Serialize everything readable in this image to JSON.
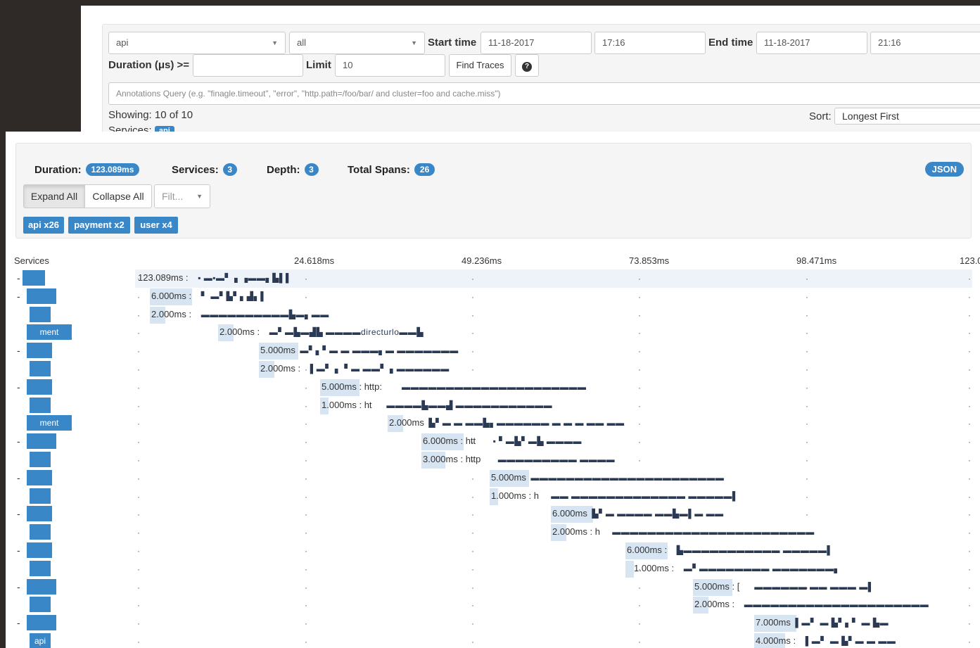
{
  "search": {
    "service_value": "api",
    "span_value": "all",
    "start_time_label": "Start time",
    "start_date": "11-18-2017",
    "start_time": "17:16",
    "end_time_label": "End time",
    "end_date": "11-18-2017",
    "end_time": "21:16",
    "duration_label": "Duration (μs) >=",
    "duration_value": "",
    "limit_label": "Limit",
    "limit_value": "10",
    "find_button": "Find Traces",
    "help_icon": "?",
    "annotations_placeholder": "Annotations Query (e.g. \"finagle.timeout\", \"error\", \"http.path=/foo/bar/ and cluster=foo and cache.miss\")",
    "showing": "Showing: 10 of 10",
    "services_label": "Services:",
    "services_badge": "api",
    "sort_label": "Sort:",
    "sort_value": "Longest First"
  },
  "trace": {
    "duration_label": "Duration:",
    "duration_value": "123.089ms",
    "services_label": "Services:",
    "services_value": "3",
    "depth_label": "Depth:",
    "depth_value": "3",
    "total_spans_label": "Total Spans:",
    "total_spans_value": "26",
    "json_button": "JSON",
    "expand_all": "Expand All",
    "collapse_all": "Collapse All",
    "filter_placeholder": "Filt...",
    "service_buttons": [
      "api x26",
      "payment x2",
      "user x4"
    ],
    "services_header": "Services",
    "axis_ticks": [
      "24.618ms",
      "49.236ms",
      "73.853ms",
      "98.471ms",
      "123.0"
    ],
    "rows": [
      {
        "toggle": "-",
        "service": "",
        "duration": "123.089ms :",
        "desc": "▪ ▬▪▬▘ ▖▗▬▬▖▙▌▌",
        "highlight": true
      },
      {
        "toggle": "-",
        "service": "",
        "duration": "6.000ms :",
        "desc": "▘ ▬▘▙▘▖▟▖▌",
        "highlight": false
      },
      {
        "toggle": "",
        "service": "",
        "duration": "2.000ms :",
        "desc": "▬▬▬▬▬▬▬▬▬▬▙▬▖▬▬",
        "highlight": false
      },
      {
        "toggle": "",
        "service": "ment",
        "duration": "2.000ms :",
        "desc": "▬▘▬▙▬▟▙ ▬▬▬▬directurlo▬▬▙",
        "highlight": false
      },
      {
        "toggle": "-",
        "service": "",
        "duration": "5.000ms",
        "desc": "▬▘▖▘▬ ▬ ▬▬▬▖▬ ▬▬▬▬▬▬▬",
        "highlight": false
      },
      {
        "toggle": "",
        "service": "",
        "duration": "2.000ms :",
        "desc": "▌▬▘ ▖ ▘▬ ▬▬▘ ▖▬▬▬▬▬▬",
        "highlight": false
      },
      {
        "toggle": "-",
        "service": "",
        "duration": "5.000ms : http:",
        "desc": "▬▬▬▬▬▬▬▬▬▬▬▬▬▬▬▬▬▬▬▬▬",
        "highlight": false
      },
      {
        "toggle": "",
        "service": "",
        "duration": "1.000ms : ht",
        "desc": "▬▬▬▬▙▬▬▟ ▬▬▬▬▬▬▬▬▬▬▬",
        "highlight": false
      },
      {
        "toggle": "",
        "service": "ment",
        "duration": "2.000ms",
        "desc": "▙▘▬ ▬ ▬▬▙▖▬▬▬▬▬▬ ▬ ▬ ▬ ▬▬ ▬▬",
        "highlight": false
      },
      {
        "toggle": "-",
        "service": "",
        "duration": "6.000ms : htt",
        "desc": "▪ ▘▬▙▘▬▙ ▬▬▬▬",
        "highlight": false
      },
      {
        "toggle": "",
        "service": "",
        "duration": "3.000ms : http",
        "desc": "▬▬▬▬▬▬▬▬▬ ▬▬▬▬",
        "highlight": false
      },
      {
        "toggle": "-",
        "service": "",
        "duration": "5.000ms",
        "desc": "▬▬▬▬▬▬▬▬▬▬▬▬▬▬▬▬▬▬▬▬▬▬",
        "highlight": false
      },
      {
        "toggle": "",
        "service": "",
        "duration": "1.000ms : h",
        "desc": "▬▬ ▬▬▬▬▬▬▬▬▬▬▬▬▬ ▬▬▬▬▬▌",
        "highlight": false
      },
      {
        "toggle": "-",
        "service": "",
        "duration": "6.000ms",
        "desc": "▙▘▬ ▬▬▬▬ ▬▬▙▬▌▬ ▬▬",
        "highlight": false
      },
      {
        "toggle": "",
        "service": "",
        "duration": "2.000ms : h",
        "desc": "▬▬▬▬▬▬▬▬▬▬▬▬▬▬▬▬▬▬▬▬▬▬▬",
        "highlight": false
      },
      {
        "toggle": "-",
        "service": "",
        "duration": "6.000ms :",
        "desc": "▙▬▬▬▬▬▬▬▬▬▬▬ ▬▬▬▬▬▌",
        "highlight": false
      },
      {
        "toggle": "",
        "service": "",
        "duration": "1.000ms :",
        "desc": "▬▘▬▬▬▬▬▬▬▬ ▬▬▬▬▬▬▬▖",
        "highlight": false
      },
      {
        "toggle": "-",
        "service": "",
        "duration": "5.000ms : [",
        "desc": "▬▬▬▬▬▬ ▬▬ ▬▬▬ ▬▌",
        "highlight": false
      },
      {
        "toggle": "",
        "service": "",
        "duration": "2.000ms :",
        "desc": "▬▬▬▬▬▬▬▬▬▬▬▬▬▬▬▬▬▬▬▬▬",
        "highlight": false
      },
      {
        "toggle": "-",
        "service": "",
        "duration": "7.000ms",
        "desc": "▌▬▘ ▬ ▙▘▖▘ ▬ ▙▬",
        "highlight": false
      },
      {
        "toggle": "",
        "service": "api",
        "duration": "4.000ms :",
        "desc": "▌▬▘ ▬ ▙▘▬ ▬ ▬▬",
        "highlight": false
      }
    ]
  }
}
